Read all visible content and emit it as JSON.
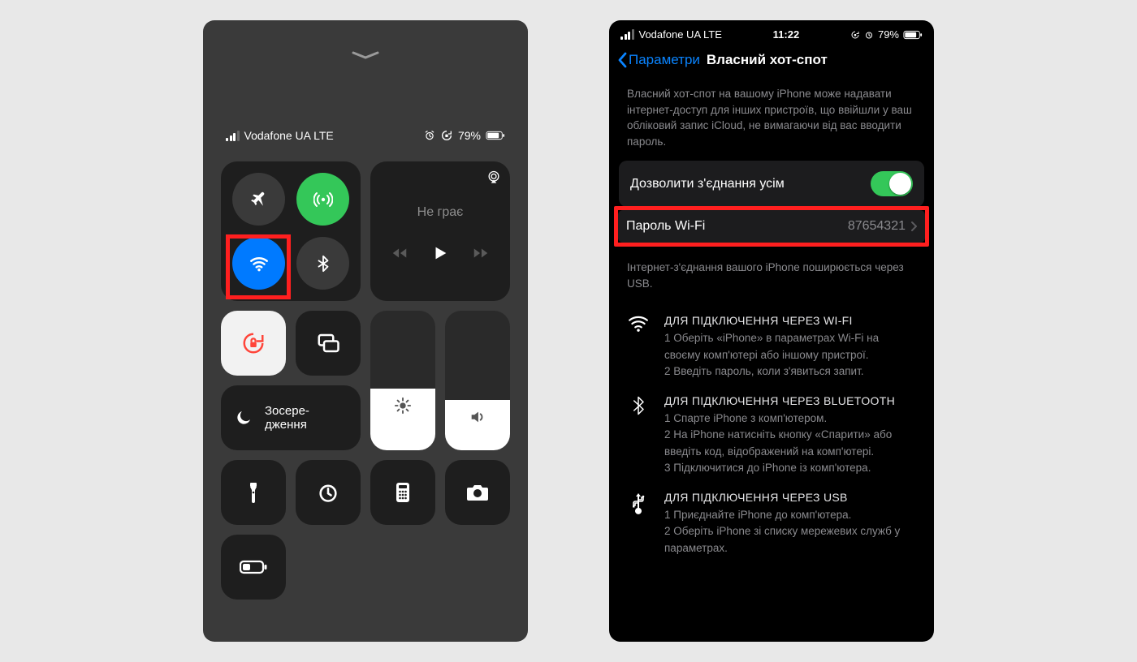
{
  "cc": {
    "status": {
      "carrier": "Vodafone UA  LTE",
      "battery": "79%"
    },
    "media": {
      "title": "Не грає"
    },
    "focus": {
      "label": "Зосере-\nдження"
    }
  },
  "settings": {
    "status": {
      "carrier": "Vodafone UA   LTE",
      "time": "11:22",
      "battery": "79%"
    },
    "nav": {
      "back": "Параметри",
      "title": "Власний хот-спот"
    },
    "intro": "Власний хот-спот на вашому iPhone може надавати інтернет-доступ для інших пристроїв, що ввійшли у ваш обліковий запис iCloud, не вимагаючи від вас вводити пароль.",
    "allow": {
      "label": "Дозволити з'єднання усім",
      "on": true
    },
    "password": {
      "label": "Пароль Wi-Fi",
      "value": "87654321"
    },
    "usb_desc": "Інтернет-з'єднання вашого iPhone поширюється через USB.",
    "help": {
      "wifi": {
        "h": "ДЛЯ ПІДКЛЮЧЕННЯ ЧЕРЕЗ WI-FI",
        "l1": "1 Оберіть «iPhone» в параметрах Wi-Fi на своєму комп'ютері або іншому пристрої.",
        "l2": "2 Введіть пароль, коли з'явиться запит."
      },
      "bt": {
        "h": "ДЛЯ ПІДКЛЮЧЕННЯ ЧЕРЕЗ BLUETOOTH",
        "l1": "1 Спарте iPhone з комп'ютером.",
        "l2": "2 На iPhone натисніть кнопку «Спарити» або введіть код, відображений на комп'ютері.",
        "l3": "3 Підключитися до iPhone із комп'ютера."
      },
      "usb": {
        "h": "ДЛЯ ПІДКЛЮЧЕННЯ ЧЕРЕЗ USB",
        "l1": "1 Приєднайте iPhone до комп'ютера.",
        "l2": "2 Оберіть iPhone зі списку мережевих служб у параметрах."
      }
    }
  }
}
